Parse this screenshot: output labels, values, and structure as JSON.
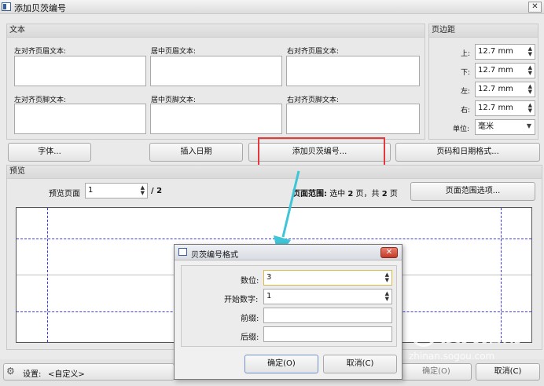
{
  "window": {
    "title": "添加贝茨编号",
    "close": "✕"
  },
  "text_group": {
    "title": "文本",
    "left_header": "左对齐页眉文本:",
    "center_header": "居中页眉文本:",
    "right_header": "右对齐页眉文本:",
    "left_footer": "左对齐页脚文本:",
    "center_footer": "居中页脚文本:",
    "right_footer": "右对齐页脚文本:"
  },
  "margin_group": {
    "title": "页边距",
    "top_label": "上:",
    "top_value": "12.7 mm",
    "bottom_label": "下:",
    "bottom_value": "12.7 mm",
    "left_label": "左:",
    "left_value": "12.7 mm",
    "right_label": "右:",
    "right_value": "12.7 mm",
    "unit_label": "单位:",
    "unit_value": "毫米"
  },
  "buttons": {
    "font": "字体...",
    "insert_date": "插入日期",
    "add_bates": "添加贝茨编号...",
    "page_date_format": "页码和日期格式..."
  },
  "preview": {
    "title": "预览",
    "page_label": "预览页面",
    "page_value": "1",
    "page_total": "/ 2",
    "range_label": "页面范围:",
    "range_selected": "选中",
    "range_current": "2",
    "range_page1": "页，共",
    "range_total": "2",
    "range_page2": "页",
    "range_options": "页面范围选项..."
  },
  "footer": {
    "settings_label": "设置:",
    "settings_value": "<自定义>",
    "ok": "确定(O)",
    "cancel": "取消(C)"
  },
  "dialog": {
    "title": "贝茨编号格式",
    "digits_label": "数位:",
    "digits_value": "3",
    "start_label": "开始数字:",
    "start_value": "1",
    "prefix_label": "前缀:",
    "prefix_value": "",
    "suffix_label": "后缀:",
    "suffix_value": "",
    "ok": "确定(O)",
    "cancel": "取消(C)"
  },
  "watermark": {
    "brand": "搜狗指南",
    "url": "zhinan.sogou.com"
  },
  "colors": {
    "highlight": "#e23a3a",
    "arrow": "#3ec6d8",
    "guide": "#3a3af0"
  }
}
